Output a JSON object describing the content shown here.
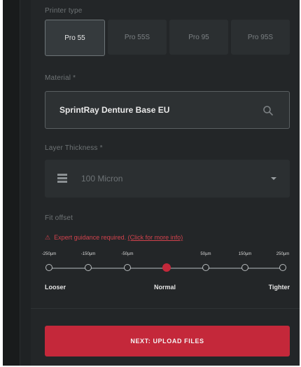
{
  "printer": {
    "section_label": "Printer type",
    "options": [
      "Pro 55",
      "Pro 55S",
      "Pro 95",
      "Pro 95S"
    ],
    "selected": "Pro 55"
  },
  "material": {
    "section_label": "Material *",
    "value": "SprintRay Denture Base EU"
  },
  "layer": {
    "section_label": "Layer Thickness *",
    "value": "100 Micron"
  },
  "fit": {
    "section_label": "Fit offset",
    "warning_text": "Expert guidance required.",
    "warning_link": "(Click for more info)",
    "ticks": [
      "-250µm",
      "-150µm",
      "-50µm",
      "",
      "50µm",
      "150µm",
      "250µm"
    ],
    "selected_index": 3,
    "left_label": "Looser",
    "mid_label": "Normal",
    "right_label": "Tighter"
  },
  "cta": {
    "label": "NEXT: UPLOAD FILES"
  },
  "colors": {
    "accent": "#c4283a",
    "background": "#232628"
  }
}
